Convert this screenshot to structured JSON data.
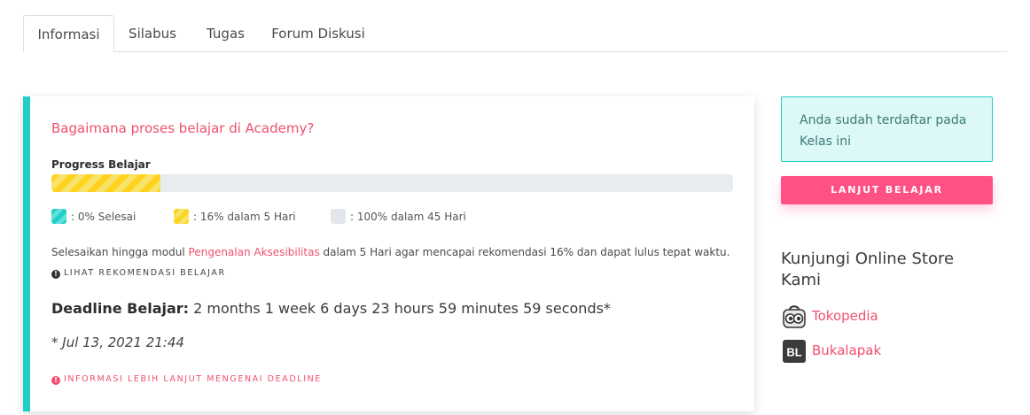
{
  "tabs": [
    {
      "label": "Informasi",
      "active": true
    },
    {
      "label": "Silabus",
      "active": false
    },
    {
      "label": "Tugas",
      "active": false
    },
    {
      "label": "Forum Diskusi",
      "active": false
    }
  ],
  "card": {
    "question": "Bagaimana proses belajar di Academy?",
    "progress_label": "Progress Belajar",
    "progress_recommended_fraction": 0.16,
    "legend": [
      {
        "label": ": 0% Selesai",
        "color": "#1fcfc6"
      },
      {
        "label": ": 16% dalam 5 Hari",
        "color": "#ffd21f"
      },
      {
        "label": ": 100% dalam 45 Hari",
        "color": "#e3e6ea"
      }
    ],
    "desc_before": "Selesaikan hingga modul ",
    "desc_link": "Pengenalan Aksesibilitas",
    "desc_after": " dalam 5 Hari agar mencapai rekomendasi 16% dan dapat lulus tepat waktu.",
    "recommendation_link": "LIHAT REKOMENDASI BELAJAR",
    "deadline_label": "Deadline Belajar:",
    "deadline_value": " 2 months 1 week 6 days 23 hours 59 minutes 59 seconds*",
    "deadline_note": "* Jul 13, 2021 21:44",
    "more_info_link": "INFORMASI LEBIH LANJUT MENGENAI DEADLINE"
  },
  "sidebar": {
    "enrolled_text": "Anda sudah terdaftar pada Kelas ini",
    "continue_button": "LANJUT BELAJAR",
    "store_title": "Kunjungi Online Store Kami",
    "stores": [
      {
        "label": "Tokopedia",
        "icon": "tokopedia-icon"
      },
      {
        "label": "Bukalapak",
        "icon": "bukalapak-icon"
      }
    ],
    "bukalapak_logo_text": "BL"
  },
  "colors": {
    "accent": "#1fcfc6",
    "pink": "#f0506e",
    "button": "#ff5184"
  }
}
